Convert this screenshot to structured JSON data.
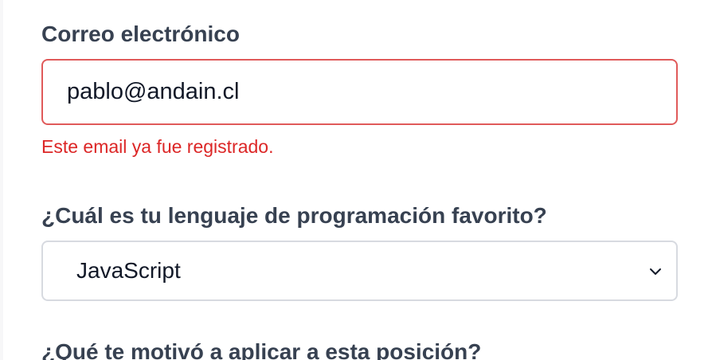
{
  "form": {
    "email": {
      "label": "Correo electrónico",
      "value": "pablo@andain.cl",
      "error": "Este email ya fue registrado."
    },
    "favorite_language": {
      "label": "¿Cuál es tu lenguaje de programación favorito?",
      "selected": "JavaScript",
      "icon": "chevron-down-icon"
    },
    "motivation": {
      "label": "¿Qué te motivó a aplicar a esta posición?"
    }
  },
  "colors": {
    "label": "#374151",
    "error": "#dc2626",
    "error_border": "#e05a5a",
    "input_border": "#d7dae0",
    "background": "#ffffff"
  }
}
